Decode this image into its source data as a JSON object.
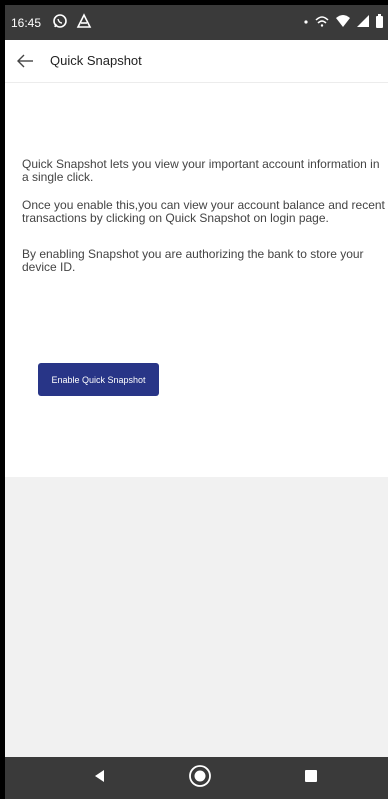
{
  "status_bar": {
    "time": "16:45",
    "icons": [
      "whatsapp-icon",
      "notification-icon",
      "dot-icon",
      "lte-icon",
      "wifi-icon",
      "signal-icon",
      "battery-icon"
    ]
  },
  "app_bar": {
    "title": "Quick Snapshot",
    "back_icon": "arrow-left-icon"
  },
  "content": {
    "paragraphs": [
      {
        "line1": "Quick Snapshot lets you view your important account information in",
        "line2": "a single click."
      },
      {
        "line1": "Once you enable this,you can view your account balance and recent",
        "line2": "transactions by clicking on Quick Snapshot on login page."
      },
      {
        "line1": "By enabling Snapshot you are authorizing the bank to store your",
        "line2": "device ID."
      }
    ],
    "enable_button_label": "Enable Quick Snapshot"
  },
  "nav_bar": {
    "icons": [
      "back-triangle-icon",
      "home-circle-icon",
      "recents-square-icon"
    ]
  },
  "colors": {
    "accent": "#283587",
    "system_bar": "#3a3a3a",
    "body_text": "#444444",
    "lower_background": "#f1f1f1"
  }
}
